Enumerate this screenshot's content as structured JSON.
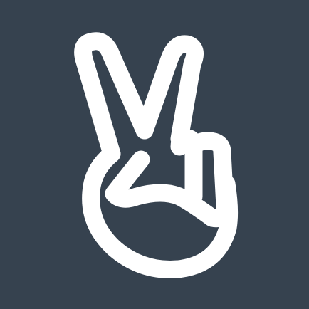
{
  "icon": {
    "semantic_name": "victory-hand-icon",
    "background_color": "#36424f",
    "foreground_color": "#ffffff"
  }
}
